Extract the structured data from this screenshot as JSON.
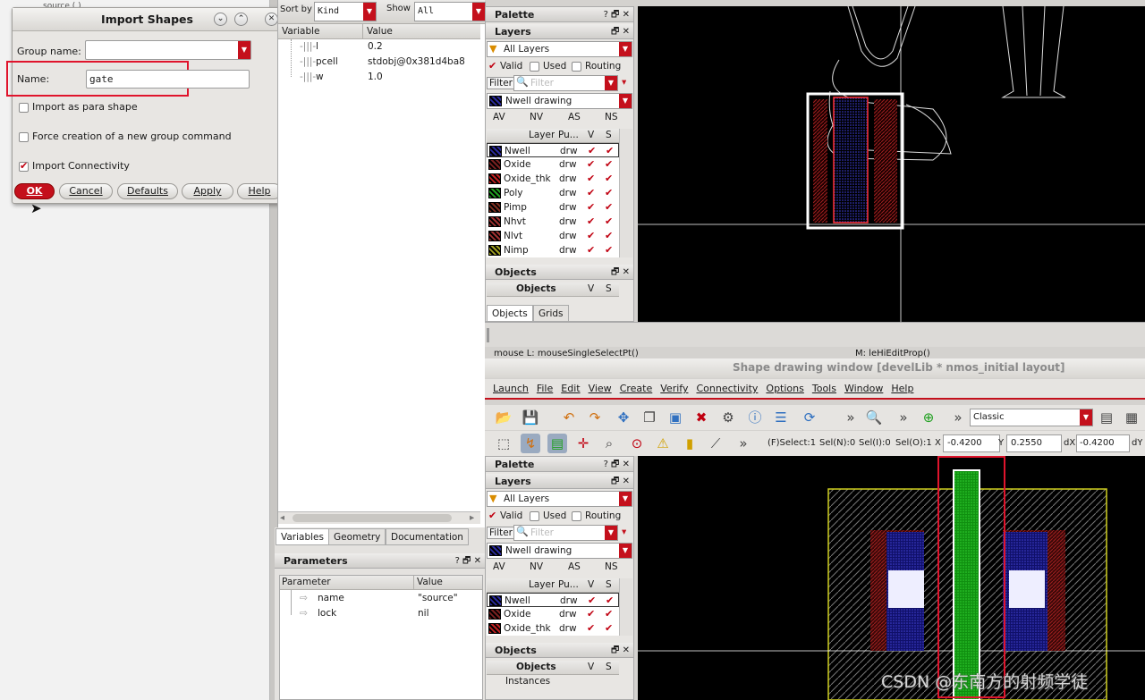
{
  "dialog": {
    "title": "Import Shapes",
    "group_name_label": "Group name:",
    "group_name_value": "",
    "name_label": "Name:",
    "name_value": "gate",
    "options": [
      {
        "label": "Import as para shape",
        "checked": false
      },
      {
        "label": "Force creation of a new group command",
        "checked": false
      },
      {
        "label": "Import Connectivity",
        "checked": true
      }
    ],
    "buttons": [
      "OK",
      "Cancel",
      "Defaults",
      "Apply",
      "Help"
    ]
  },
  "topleft_fragment": "source ( )",
  "prop_panel": {
    "sort_by_label": "Sort by",
    "sort_by_value": "Kind",
    "show_label": "Show",
    "show_value": "All",
    "col_variable": "Variable",
    "col_value": "Value",
    "rows": [
      {
        "name": "l",
        "value": "0.2"
      },
      {
        "name": "pcell",
        "value": "stdobj@0x381d4ba8"
      },
      {
        "name": "w",
        "value": "1.0"
      }
    ],
    "tabs": [
      "Variables",
      "Geometry",
      "Documentation"
    ],
    "params_title": "Parameters",
    "params_col_param": "Parameter",
    "params_col_value": "Value",
    "params": [
      {
        "name": "name",
        "value": "\"source\""
      },
      {
        "name": "lock",
        "value": "nil"
      }
    ]
  },
  "palette_top": {
    "title": "Palette",
    "layers_title": "Layers",
    "all_layers": "All Layers",
    "valid_label": "Valid",
    "used_label": "Used",
    "routing_label": "Routing",
    "filter_label": "Filter",
    "filter_placeholder": "Filter",
    "current_layer": "Nwell drawing",
    "abbrev": [
      "AV",
      "NV",
      "AS",
      "NS"
    ],
    "col_layer": "Layer",
    "col_purpose": "Pu...",
    "col_v": "V",
    "col_s": "S",
    "layers": [
      {
        "name": "Nwell",
        "purpose": "drw",
        "color": "#2a2aa0"
      },
      {
        "name": "Oxide",
        "purpose": "drw",
        "color": "#7a2020"
      },
      {
        "name": "Oxide_thk",
        "purpose": "drw",
        "color": "#c02020"
      },
      {
        "name": "Poly",
        "purpose": "drw",
        "color": "#20a020"
      },
      {
        "name": "Pimp",
        "purpose": "drw",
        "color": "#803020"
      },
      {
        "name": "Nhvt",
        "purpose": "drw",
        "color": "#a03030"
      },
      {
        "name": "Nlvt",
        "purpose": "drw",
        "color": "#a03030"
      },
      {
        "name": "Nimp",
        "purpose": "drw",
        "color": "#a0a020"
      }
    ],
    "objects_title": "Objects",
    "objects_col": "Objects",
    "tabs": [
      "Objects",
      "Grids"
    ]
  },
  "status": {
    "mouse_l": "mouse L: mouseSingleSelectPt()",
    "mouse_m": "M: leHiEditProp()"
  },
  "layout_window": {
    "title": "Shape drawing window [develLib * nmos_initial layout]",
    "menus": [
      "Launch",
      "File",
      "Edit",
      "View",
      "Create",
      "Verify",
      "Connectivity",
      "Options",
      "Tools",
      "Window",
      "Help"
    ],
    "style_value": "Classic",
    "select_status": "(F)Select:1",
    "sel_n": "Sel(N):0",
    "sel_i": "Sel(I):0",
    "sel_o": "Sel(O):1",
    "x_label": "X",
    "x_value": "-0.4200",
    "y_label": "Y",
    "y_value": "0.2550",
    "dx_label": "dX",
    "dx_value": "-0.4200",
    "dy_label": "dY"
  },
  "palette_bottom": {
    "title": "Palette",
    "layers_title": "Layers",
    "all_layers": "All Layers",
    "valid_label": "Valid",
    "used_label": "Used",
    "routing_label": "Routing",
    "filter_label": "Filter",
    "filter_placeholder": "Filter",
    "current_layer": "Nwell drawing",
    "abbrev": [
      "AV",
      "NV",
      "AS",
      "NS"
    ],
    "col_layer": "Layer",
    "col_purpose": "Pu...",
    "col_v": "V",
    "col_s": "S",
    "layers": [
      {
        "name": "Nwell",
        "purpose": "drw",
        "color": "#2a2aa0"
      },
      {
        "name": "Oxide",
        "purpose": "drw",
        "color": "#7a2020"
      },
      {
        "name": "Oxide_thk",
        "purpose": "drw",
        "color": "#c02020"
      }
    ],
    "objects_title": "Objects",
    "objects_col": "Objects",
    "instances": "Instances"
  },
  "watermark": "CSDN @东南方的射频学徒"
}
